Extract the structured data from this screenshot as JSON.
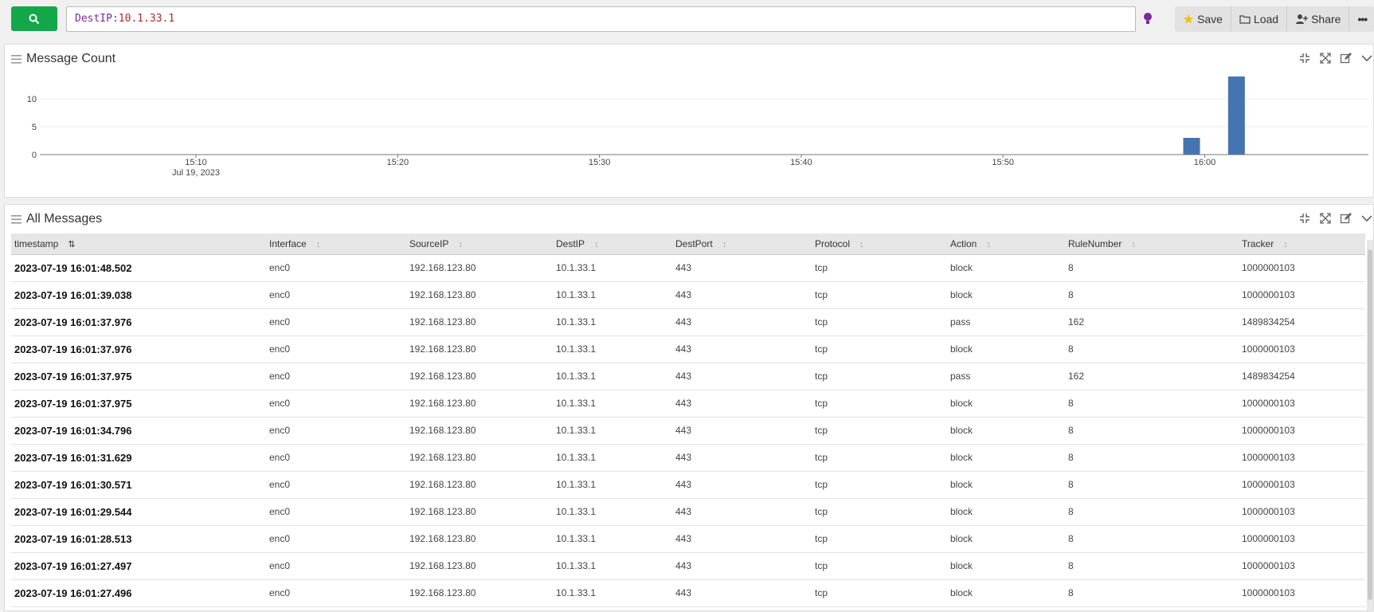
{
  "search": {
    "field": "DestIP",
    "sep": ":",
    "value": "10.1.33.1"
  },
  "actions": [
    {
      "icon": "star-icon",
      "label": "Save"
    },
    {
      "icon": "folder-icon",
      "label": "Load"
    },
    {
      "icon": "user-plus-icon",
      "label": "Share"
    },
    {
      "icon": "more-icon",
      "label": "•••"
    }
  ],
  "panel_chart": {
    "title": "Message Count"
  },
  "panel_table": {
    "title": "All Messages"
  },
  "chart_data": {
    "type": "bar",
    "title": "Message Count",
    "x_ticks": [
      "15:10",
      "15:20",
      "15:30",
      "15:40",
      "15:50",
      "16:00"
    ],
    "x_date_label": "Jul 19, 2023",
    "y_ticks": [
      0,
      5,
      10
    ],
    "ylim": [
      0,
      14
    ],
    "x": [
      "16:00",
      "16:01"
    ],
    "values": [
      3,
      14
    ],
    "color": "#4574b1"
  },
  "table": {
    "columns": [
      "timestamp",
      "Interface",
      "SourceIP",
      "DestIP",
      "DestPort",
      "Protocol",
      "Action",
      "RuleNumber",
      "Tracker"
    ],
    "rows": [
      [
        "2023-07-19 16:01:48.502",
        "enc0",
        "192.168.123.80",
        "10.1.33.1",
        "443",
        "tcp",
        "block",
        "8",
        "1000000103"
      ],
      [
        "2023-07-19 16:01:39.038",
        "enc0",
        "192.168.123.80",
        "10.1.33.1",
        "443",
        "tcp",
        "block",
        "8",
        "1000000103"
      ],
      [
        "2023-07-19 16:01:37.976",
        "enc0",
        "192.168.123.80",
        "10.1.33.1",
        "443",
        "tcp",
        "pass",
        "162",
        "1489834254"
      ],
      [
        "2023-07-19 16:01:37.976",
        "enc0",
        "192.168.123.80",
        "10.1.33.1",
        "443",
        "tcp",
        "block",
        "8",
        "1000000103"
      ],
      [
        "2023-07-19 16:01:37.975",
        "enc0",
        "192.168.123.80",
        "10.1.33.1",
        "443",
        "tcp",
        "pass",
        "162",
        "1489834254"
      ],
      [
        "2023-07-19 16:01:37.975",
        "enc0",
        "192.168.123.80",
        "10.1.33.1",
        "443",
        "tcp",
        "block",
        "8",
        "1000000103"
      ],
      [
        "2023-07-19 16:01:34.796",
        "enc0",
        "192.168.123.80",
        "10.1.33.1",
        "443",
        "tcp",
        "block",
        "8",
        "1000000103"
      ],
      [
        "2023-07-19 16:01:31.629",
        "enc0",
        "192.168.123.80",
        "10.1.33.1",
        "443",
        "tcp",
        "block",
        "8",
        "1000000103"
      ],
      [
        "2023-07-19 16:01:30.571",
        "enc0",
        "192.168.123.80",
        "10.1.33.1",
        "443",
        "tcp",
        "block",
        "8",
        "1000000103"
      ],
      [
        "2023-07-19 16:01:29.544",
        "enc0",
        "192.168.123.80",
        "10.1.33.1",
        "443",
        "tcp",
        "block",
        "8",
        "1000000103"
      ],
      [
        "2023-07-19 16:01:28.513",
        "enc0",
        "192.168.123.80",
        "10.1.33.1",
        "443",
        "tcp",
        "block",
        "8",
        "1000000103"
      ],
      [
        "2023-07-19 16:01:27.497",
        "enc0",
        "192.168.123.80",
        "10.1.33.1",
        "443",
        "tcp",
        "block",
        "8",
        "1000000103"
      ],
      [
        "2023-07-19 16:01:27.496",
        "enc0",
        "192.168.123.80",
        "10.1.33.1",
        "443",
        "tcp",
        "block",
        "8",
        "1000000103"
      ]
    ]
  }
}
